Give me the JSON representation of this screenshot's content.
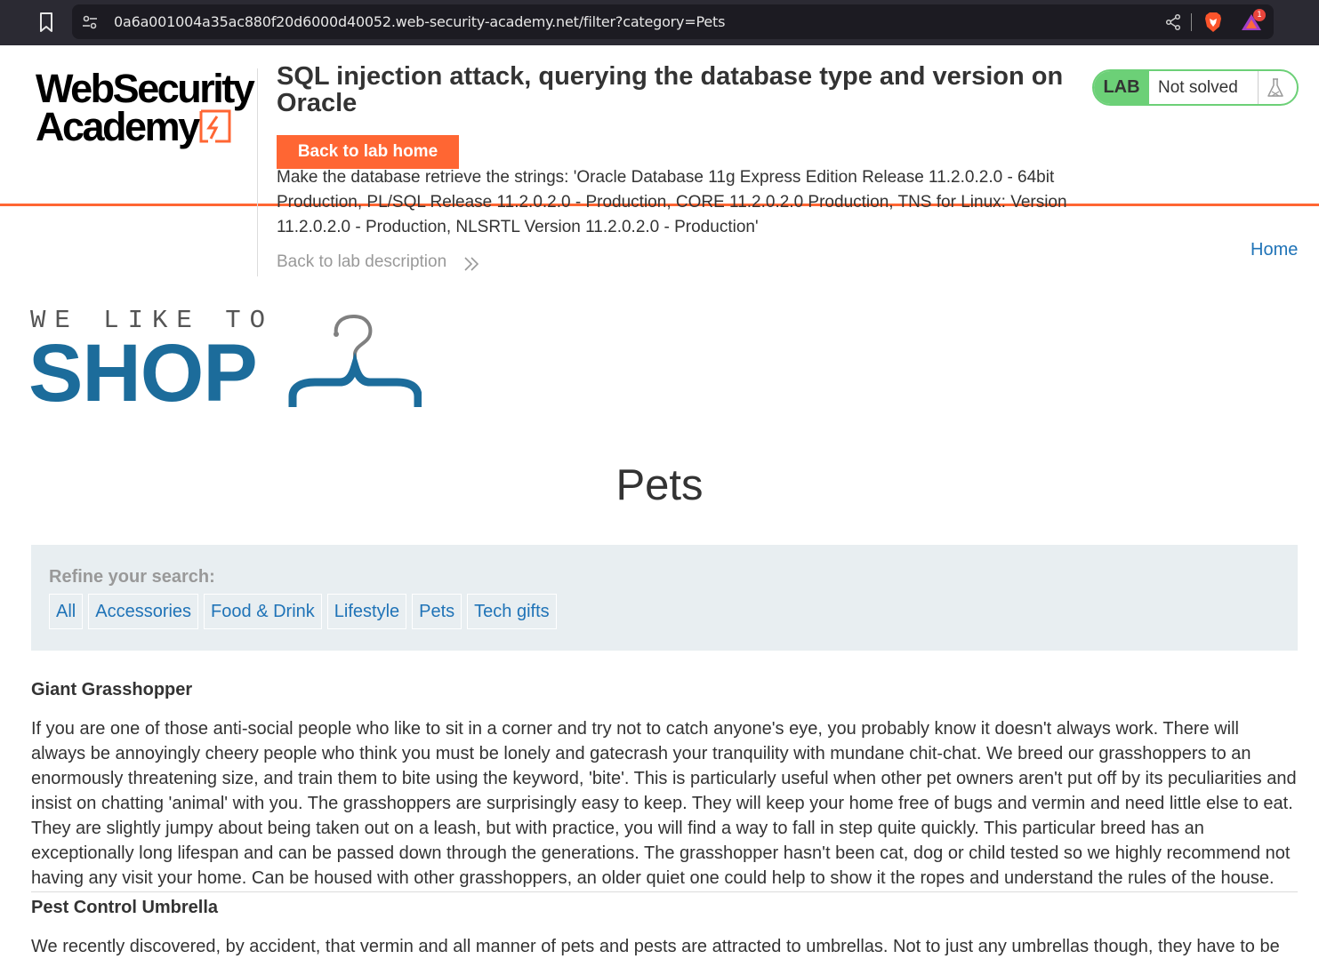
{
  "browser": {
    "url": "0a6a001004a35ac880f20d6000d40052.web-security-academy.net/filter?category=Pets",
    "rewards_count": "1",
    "icons": [
      "bookmark-icon",
      "site-settings-icon",
      "share-icon",
      "brave-shield-icon",
      "brave-rewards-icon"
    ]
  },
  "lab": {
    "logo_line1": "WebSecurity",
    "logo_line2": "Academy",
    "title": "SQL injection attack, querying the database type and version on Oracle",
    "back_to_lab_home": "Back to lab home",
    "description": "Make the database retrieve the strings: 'Oracle Database 11g Express Edition Release 11.2.0.2.0 - 64bit Production, PL/SQL Release 11.2.0.2.0 - Production, CORE 11.2.0.2.0 Production, TNS for Linux: Version 11.2.0.2.0 - Production, NLSRTL Version 11.2.0.2.0 - Production'",
    "back_to_description": "Back to lab description",
    "status_badge": "LAB",
    "status_text": "Not solved",
    "accent_color": "#ff6633",
    "status_color": "#6cd077"
  },
  "nav": {
    "home": "Home"
  },
  "shop": {
    "tagline": "WE LIKE TO",
    "brand": "SHOP",
    "brand_color": "#1c6c9b"
  },
  "page": {
    "heading": "Pets"
  },
  "filters": {
    "label": "Refine your search:",
    "items": [
      "All",
      "Accessories",
      "Food & Drink",
      "Lifestyle",
      "Pets",
      "Tech gifts"
    ]
  },
  "products": [
    {
      "name": "Giant Grasshopper",
      "description": "If you are one of those anti-social people who like to sit in a corner and try not to catch anyone's eye, you probably know it doesn't always work. There will always be annoyingly cheery people who think you must be lonely and gatecrash your tranquility with mundane chit-chat. We breed our grasshoppers to an enormously threatening size, and train them to bite using the keyword, 'bite'. This is particularly useful when other pet owners aren't put off by its peculiarities and insist on chatting 'animal' with you. The grasshoppers are surprisingly easy to keep. They will keep your home free of bugs and vermin and need little else to eat. They are slightly jumpy about being taken out on a leash, but with practice, you will find a way to fall in step quite quickly. This particular breed has an exceptionally long lifespan and can be passed down through the generations. The grasshopper hasn't been cat, dog or child tested so we highly recommend not having any visit your home. Can be housed with other grasshoppers, an older quiet one could help to show it the ropes and understand the rules of the house."
    },
    {
      "name": "Pest Control Umbrella",
      "description": "We recently discovered, by accident, that vermin and all manner of pets and pests are attracted to umbrellas. Not to just any umbrellas though, they have to be"
    }
  ]
}
